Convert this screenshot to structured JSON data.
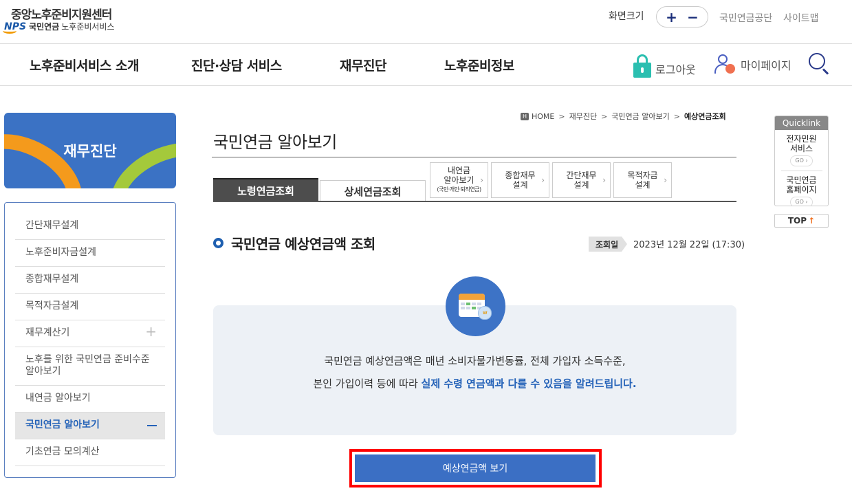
{
  "header": {
    "logo_title": "중앙노후준비지원센터",
    "logo_brand": "NPS",
    "logo_sub_bold": "국민연금",
    "logo_sub": "노후준비서비스",
    "fontsize_label": "화면크기",
    "fontsize_plus": "+",
    "fontsize_minus": "−",
    "links": [
      "국민연금공단",
      "사이트맵"
    ]
  },
  "gnb": {
    "items": [
      "노후준비서비스 소개",
      "진단·상담 서비스",
      "재무진단",
      "노후준비정보"
    ],
    "logout": "로그아웃",
    "mypage": "마이페이지",
    "icons": [
      "lock-icon",
      "user-icon",
      "search-icon"
    ],
    "accent": "#2bbfb0"
  },
  "sidebar": {
    "banner_title": "재무진단",
    "items": [
      {
        "label": "간단재무설계"
      },
      {
        "label": "노후준비자금설계"
      },
      {
        "label": "종합재무설계"
      },
      {
        "label": "목적자금설계"
      },
      {
        "label": "재무계산기",
        "toggle": "+"
      },
      {
        "label": "노후를 위한 국민연금 준비수준 알아보기"
      },
      {
        "label": "내연금 알아보기"
      },
      {
        "label": "국민연금 알아보기",
        "active": true
      },
      {
        "label": "기초연금 모의계산"
      }
    ]
  },
  "breadcrumb": {
    "home_icon": "H",
    "items": [
      "HOME",
      "재무진단",
      "국민연금 알아보기",
      "예상연금조회"
    ],
    "sep": ">"
  },
  "page": {
    "title": "국민연금 알아보기",
    "tabs": {
      "main": [
        "노령연금조회",
        "상세연금조회"
      ],
      "boxes": [
        {
          "line1": "내연금",
          "line2": "알아보기",
          "small": "(국민·개인·퇴직연금)"
        },
        {
          "line1": "종합재무",
          "line2": "설계"
        },
        {
          "line1": "간단재무",
          "line2": "설계"
        },
        {
          "line1": "목적자금",
          "line2": "설계"
        }
      ],
      "arrow": "›"
    },
    "section_title": "국민연금 예상연금액 조회",
    "date_label": "조회일",
    "date_value": "2023년 12월 22일 (17:30)",
    "info_line1": "국민연금 예상연금액은 매년 소비자물가변동률, 전체 가입자 소득수준,",
    "info_line2_plain": "본인 가입이력 등에 따라 ",
    "info_line2_highlight": "실제 수령 연금액과 다를 수 있음을 알려드립니다.",
    "button": "예상연금액 보기",
    "primary_color": "#3b6fc4",
    "highlight_color": "#ff0000"
  },
  "quicklink": {
    "head": "Quicklink",
    "items": [
      {
        "line1": "전자민원",
        "line2": "서비스",
        "go": "GO ›"
      },
      {
        "line1": "국민연금",
        "line2": "홈페이지",
        "go": "GO ›"
      }
    ],
    "top_label": "TOP",
    "top_arrow": "↑"
  }
}
